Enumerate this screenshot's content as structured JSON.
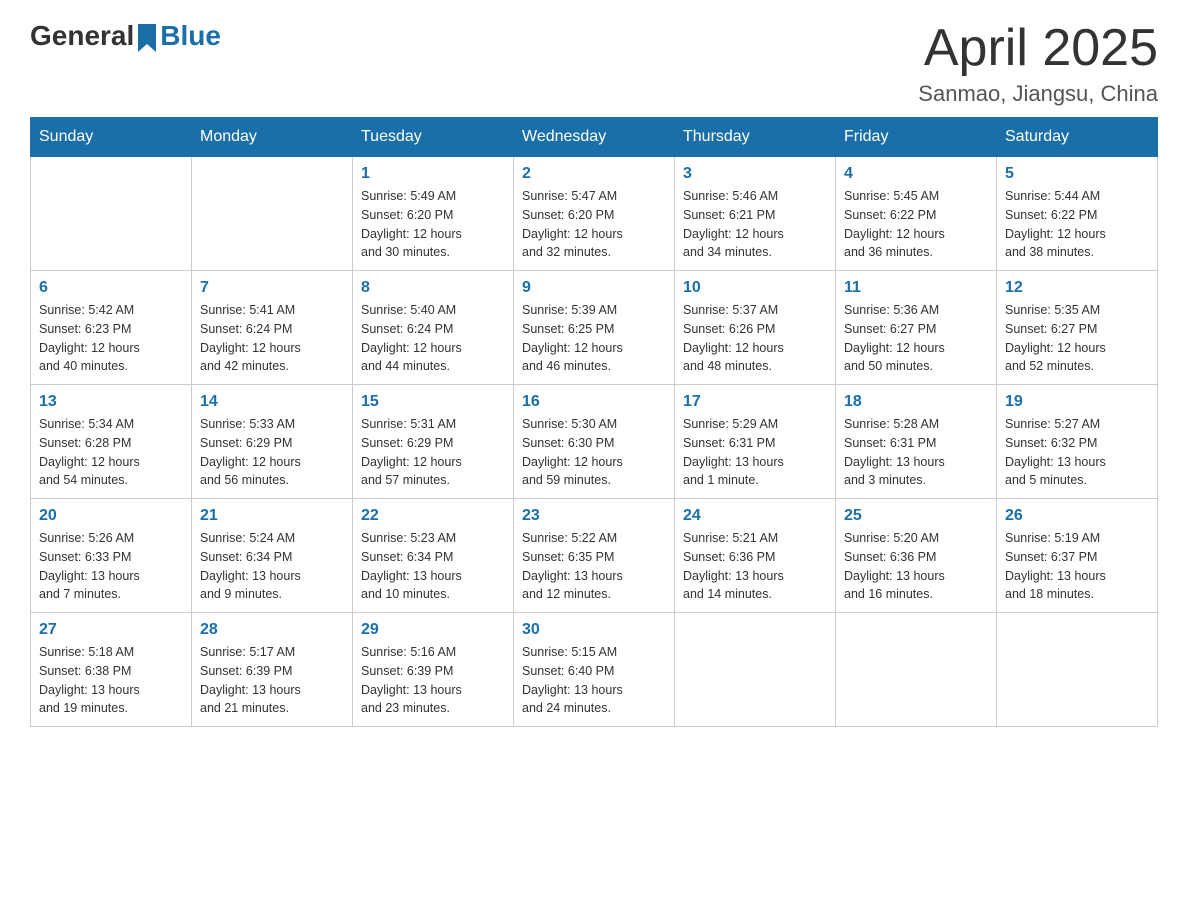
{
  "header": {
    "logo_general": "General",
    "logo_blue": "Blue",
    "title": "April 2025",
    "subtitle": "Sanmao, Jiangsu, China"
  },
  "calendar": {
    "days_of_week": [
      "Sunday",
      "Monday",
      "Tuesday",
      "Wednesday",
      "Thursday",
      "Friday",
      "Saturday"
    ],
    "weeks": [
      [
        {
          "day": "",
          "info": ""
        },
        {
          "day": "",
          "info": ""
        },
        {
          "day": "1",
          "info": "Sunrise: 5:49 AM\nSunset: 6:20 PM\nDaylight: 12 hours\nand 30 minutes."
        },
        {
          "day": "2",
          "info": "Sunrise: 5:47 AM\nSunset: 6:20 PM\nDaylight: 12 hours\nand 32 minutes."
        },
        {
          "day": "3",
          "info": "Sunrise: 5:46 AM\nSunset: 6:21 PM\nDaylight: 12 hours\nand 34 minutes."
        },
        {
          "day": "4",
          "info": "Sunrise: 5:45 AM\nSunset: 6:22 PM\nDaylight: 12 hours\nand 36 minutes."
        },
        {
          "day": "5",
          "info": "Sunrise: 5:44 AM\nSunset: 6:22 PM\nDaylight: 12 hours\nand 38 minutes."
        }
      ],
      [
        {
          "day": "6",
          "info": "Sunrise: 5:42 AM\nSunset: 6:23 PM\nDaylight: 12 hours\nand 40 minutes."
        },
        {
          "day": "7",
          "info": "Sunrise: 5:41 AM\nSunset: 6:24 PM\nDaylight: 12 hours\nand 42 minutes."
        },
        {
          "day": "8",
          "info": "Sunrise: 5:40 AM\nSunset: 6:24 PM\nDaylight: 12 hours\nand 44 minutes."
        },
        {
          "day": "9",
          "info": "Sunrise: 5:39 AM\nSunset: 6:25 PM\nDaylight: 12 hours\nand 46 minutes."
        },
        {
          "day": "10",
          "info": "Sunrise: 5:37 AM\nSunset: 6:26 PM\nDaylight: 12 hours\nand 48 minutes."
        },
        {
          "day": "11",
          "info": "Sunrise: 5:36 AM\nSunset: 6:27 PM\nDaylight: 12 hours\nand 50 minutes."
        },
        {
          "day": "12",
          "info": "Sunrise: 5:35 AM\nSunset: 6:27 PM\nDaylight: 12 hours\nand 52 minutes."
        }
      ],
      [
        {
          "day": "13",
          "info": "Sunrise: 5:34 AM\nSunset: 6:28 PM\nDaylight: 12 hours\nand 54 minutes."
        },
        {
          "day": "14",
          "info": "Sunrise: 5:33 AM\nSunset: 6:29 PM\nDaylight: 12 hours\nand 56 minutes."
        },
        {
          "day": "15",
          "info": "Sunrise: 5:31 AM\nSunset: 6:29 PM\nDaylight: 12 hours\nand 57 minutes."
        },
        {
          "day": "16",
          "info": "Sunrise: 5:30 AM\nSunset: 6:30 PM\nDaylight: 12 hours\nand 59 minutes."
        },
        {
          "day": "17",
          "info": "Sunrise: 5:29 AM\nSunset: 6:31 PM\nDaylight: 13 hours\nand 1 minute."
        },
        {
          "day": "18",
          "info": "Sunrise: 5:28 AM\nSunset: 6:31 PM\nDaylight: 13 hours\nand 3 minutes."
        },
        {
          "day": "19",
          "info": "Sunrise: 5:27 AM\nSunset: 6:32 PM\nDaylight: 13 hours\nand 5 minutes."
        }
      ],
      [
        {
          "day": "20",
          "info": "Sunrise: 5:26 AM\nSunset: 6:33 PM\nDaylight: 13 hours\nand 7 minutes."
        },
        {
          "day": "21",
          "info": "Sunrise: 5:24 AM\nSunset: 6:34 PM\nDaylight: 13 hours\nand 9 minutes."
        },
        {
          "day": "22",
          "info": "Sunrise: 5:23 AM\nSunset: 6:34 PM\nDaylight: 13 hours\nand 10 minutes."
        },
        {
          "day": "23",
          "info": "Sunrise: 5:22 AM\nSunset: 6:35 PM\nDaylight: 13 hours\nand 12 minutes."
        },
        {
          "day": "24",
          "info": "Sunrise: 5:21 AM\nSunset: 6:36 PM\nDaylight: 13 hours\nand 14 minutes."
        },
        {
          "day": "25",
          "info": "Sunrise: 5:20 AM\nSunset: 6:36 PM\nDaylight: 13 hours\nand 16 minutes."
        },
        {
          "day": "26",
          "info": "Sunrise: 5:19 AM\nSunset: 6:37 PM\nDaylight: 13 hours\nand 18 minutes."
        }
      ],
      [
        {
          "day": "27",
          "info": "Sunrise: 5:18 AM\nSunset: 6:38 PM\nDaylight: 13 hours\nand 19 minutes."
        },
        {
          "day": "28",
          "info": "Sunrise: 5:17 AM\nSunset: 6:39 PM\nDaylight: 13 hours\nand 21 minutes."
        },
        {
          "day": "29",
          "info": "Sunrise: 5:16 AM\nSunset: 6:39 PM\nDaylight: 13 hours\nand 23 minutes."
        },
        {
          "day": "30",
          "info": "Sunrise: 5:15 AM\nSunset: 6:40 PM\nDaylight: 13 hours\nand 24 minutes."
        },
        {
          "day": "",
          "info": ""
        },
        {
          "day": "",
          "info": ""
        },
        {
          "day": "",
          "info": ""
        }
      ]
    ]
  }
}
